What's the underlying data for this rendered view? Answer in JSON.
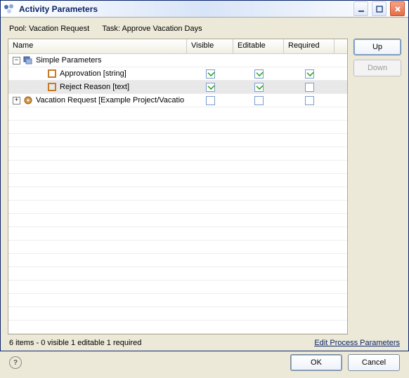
{
  "title": "Activity Parameters",
  "meta": {
    "pool_label": "Pool:",
    "pool_value": "Vacation Request",
    "task_label": "Task:",
    "task_value": "Approve Vacation Days"
  },
  "columns": {
    "name": "Name",
    "visible": "Visible",
    "editable": "Editable",
    "required": "Required"
  },
  "rows": [
    {
      "kind": "group",
      "expander": "minus",
      "indent": 0,
      "icon": "folder-stack",
      "label": "Simple Parameters",
      "visible": null,
      "editable": null,
      "required": null,
      "selected": false
    },
    {
      "kind": "leaf",
      "expander": null,
      "indent": 2,
      "icon": "orange-node",
      "label": "Approvation [string]",
      "visible": true,
      "editable": true,
      "required": true,
      "selected": false
    },
    {
      "kind": "leaf",
      "expander": null,
      "indent": 2,
      "icon": "orange-node",
      "label": "Reject Reason [text]",
      "visible": true,
      "editable": true,
      "required": false,
      "selected": true
    },
    {
      "kind": "group",
      "expander": "plus",
      "indent": 0,
      "icon": "disc",
      "label": "Vacation Request [Example Project/Vacatio",
      "visible": false,
      "editable": false,
      "required": false,
      "selected": false
    }
  ],
  "side": {
    "up": "Up",
    "down": "Down",
    "down_disabled": true
  },
  "status": "6 items - 0 visible  1 editable  1 required",
  "link": "Edit Process Parameters",
  "buttons": {
    "ok": "OK",
    "cancel": "Cancel"
  },
  "help_glyph": "?"
}
